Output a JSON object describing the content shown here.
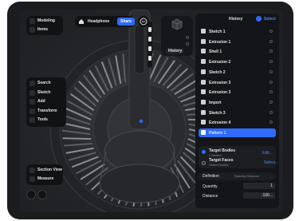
{
  "top_left": {
    "modeling": "Modeling",
    "items": "Items"
  },
  "doc": {
    "name": "Headphone",
    "share": "Share"
  },
  "view_panel": {
    "history": "History"
  },
  "tools": [
    "Search",
    "Sketch",
    "Add",
    "Transform",
    "Tools"
  ],
  "tool_icons": [
    "search-icon",
    "pencil-icon",
    "add-icon",
    "transform-icon",
    "tools-icon"
  ],
  "bottom_tools": [
    "Section View",
    "Measure"
  ],
  "history": {
    "title": "History",
    "action": "Select",
    "items": [
      {
        "label": "Sketch 1",
        "icon": "sketch-icon"
      },
      {
        "label": "Extrusion 1",
        "icon": "extrusion-icon"
      },
      {
        "label": "Shell 1",
        "icon": "shell-icon"
      },
      {
        "label": "Extrusion 2",
        "icon": "extrusion-icon"
      },
      {
        "label": "Sketch 2",
        "icon": "sketch-icon"
      },
      {
        "label": "Extrusion 3",
        "icon": "extrusion-icon"
      },
      {
        "label": "Extrusion 3",
        "icon": "extrusion-icon"
      },
      {
        "label": "Import",
        "icon": "import-icon"
      },
      {
        "label": "Sketch 3",
        "icon": "sketch-icon"
      },
      {
        "label": "Extrusion 4",
        "icon": "extrusion-icon"
      },
      {
        "label": "Pattern 1",
        "icon": "pattern-icon",
        "selected": true
      }
    ]
  },
  "pattern": {
    "target_bodies": "Target Bodies",
    "target_bodies_sub": "2 Bodies",
    "target_bodies_action": "Edit...",
    "target_faces": "Target Faces",
    "target_faces_sub": "Select Bodies",
    "target_faces_action": "Select...",
    "definition_label": "Definition",
    "definition_value": "Spacing Distance",
    "quantity_label": "Quantity",
    "quantity_value": "1",
    "distance_label": "Distance",
    "distance_value": "-100..."
  },
  "colors": {
    "accent": "#2f6bff",
    "panel": "#111214",
    "selected": "#2f6bff"
  }
}
